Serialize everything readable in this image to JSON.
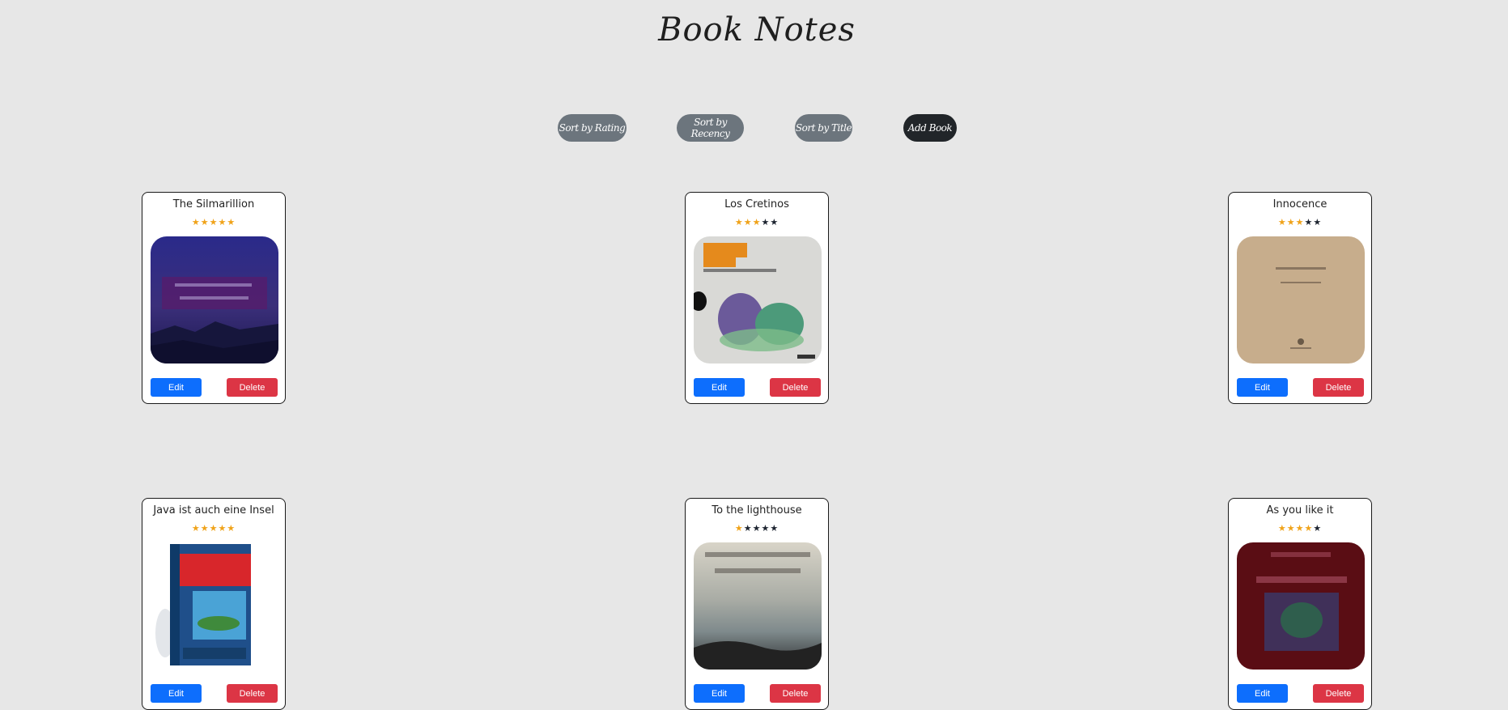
{
  "header": {
    "title": "Book Notes"
  },
  "toolbar": {
    "sort_rating": "Sort by Rating",
    "sort_recency": "Sort by Recency",
    "sort_title": "Sort by Title",
    "add_book": "Add Book"
  },
  "colors": {
    "background": "#e7e7e7",
    "star_on": "#f0a31a",
    "star_off": "#1d2430",
    "edit": "#0d6efd",
    "delete": "#dc3545",
    "pill_gray": "#6c757d",
    "pill_dark": "#212529"
  },
  "books": [
    {
      "title": "The Silmarillion",
      "rating": 5,
      "edit_label": "Edit",
      "delete_label": "Delete",
      "cover": "silmarillion"
    },
    {
      "title": "Los Cretinos",
      "rating": 3,
      "edit_label": "Edit",
      "delete_label": "Delete",
      "cover": "cretinos"
    },
    {
      "title": "Innocence",
      "rating": 3,
      "edit_label": "Edit",
      "delete_label": "Delete",
      "cover": "innocence"
    },
    {
      "title": "Java ist auch eine Insel",
      "rating": 5,
      "edit_label": "Edit",
      "delete_label": "Delete",
      "cover": "java"
    },
    {
      "title": "To the lighthouse",
      "rating": 1,
      "edit_label": "Edit",
      "delete_label": "Delete",
      "cover": "lighthouse"
    },
    {
      "title": "As you like it",
      "rating": 4,
      "edit_label": "Edit",
      "delete_label": "Delete",
      "cover": "asyoulikeit"
    }
  ]
}
